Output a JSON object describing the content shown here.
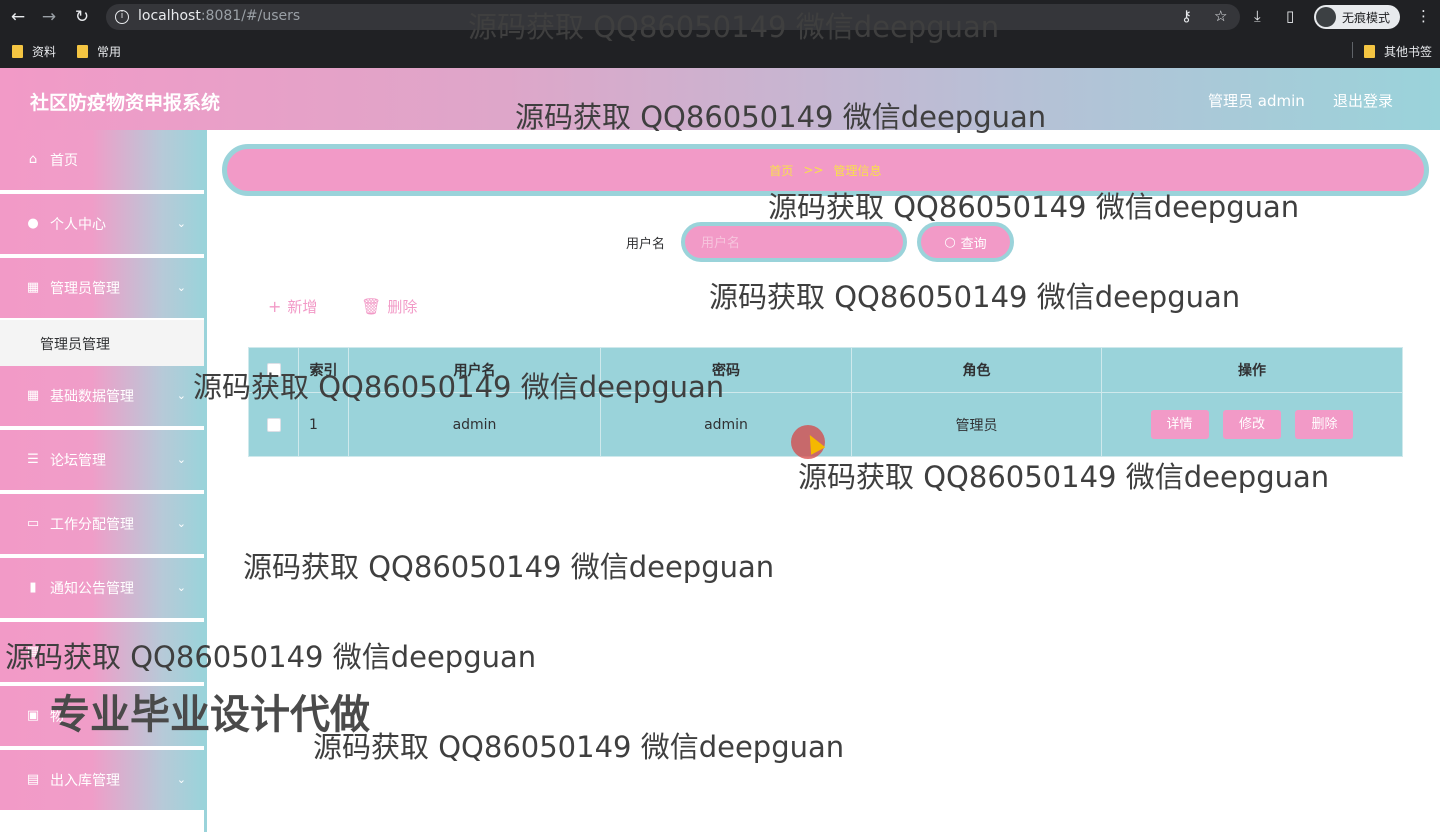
{
  "browser": {
    "url_host": "localhost",
    "url_rest": ":8081/#/users",
    "incognito_label": "无痕模式",
    "bookmarks": [
      "资料",
      "常用"
    ],
    "other_bookmarks": "其他书签"
  },
  "header": {
    "title": "社区防疫物资申报系统",
    "user_label": "管理员 admin",
    "logout_label": "退出登录"
  },
  "sidebar": {
    "items": [
      {
        "label": "首页",
        "icon": "home-icon",
        "glyph": "⌂"
      },
      {
        "label": "个人中心",
        "icon": "user-icon",
        "glyph": "●"
      },
      {
        "label": "管理员管理",
        "icon": "grid-icon",
        "glyph": "▦"
      },
      {
        "label": "基础数据管理",
        "icon": "grid-icon",
        "glyph": "▦"
      },
      {
        "label": "论坛管理",
        "icon": "sliders-icon",
        "glyph": "☰"
      },
      {
        "label": "工作分配管理",
        "icon": "monitor-icon",
        "glyph": "▭"
      },
      {
        "label": "通知公告管理",
        "icon": "bar-chart-icon",
        "glyph": "▮"
      },
      {
        "label": "",
        "icon": "menu-icon",
        "glyph": "▦"
      },
      {
        "label": "物",
        "icon": "chart-icon",
        "glyph": "▣"
      },
      {
        "label": "出入库管理",
        "icon": "clipboard-icon",
        "glyph": "▤"
      }
    ],
    "sub_item": "管理员管理"
  },
  "breadcrumb": {
    "home": "首页",
    "separator": ">>",
    "current": "管理信息"
  },
  "search": {
    "label": "用户名",
    "placeholder": "用户名",
    "button": "查询"
  },
  "actions": {
    "add": "新增",
    "delete": "删除"
  },
  "table": {
    "headers": [
      "索引",
      "用户名",
      "密码",
      "角色",
      "操作"
    ],
    "rows": [
      {
        "index": "1",
        "username": "admin",
        "password": "admin",
        "role": "管理员"
      }
    ],
    "ops": [
      "详情",
      "修改",
      "删除"
    ]
  },
  "watermarks": {
    "text": "源码获取 QQ86050149 微信deepguan",
    "big": "专业毕业设计代做"
  },
  "colors": {
    "pink": "#f29ac7",
    "teal": "#9ad3da",
    "breadcrumb_text": "#f8e04c",
    "chrome": "#202124"
  }
}
